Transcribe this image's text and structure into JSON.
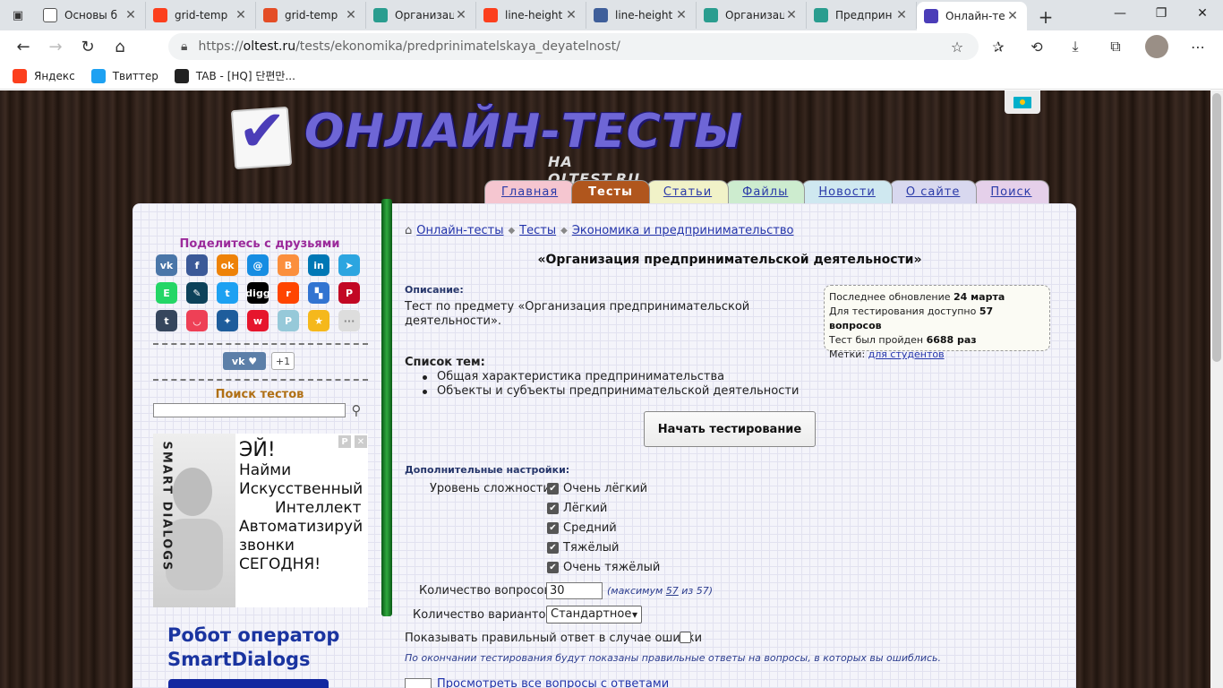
{
  "browser": {
    "tabs": [
      {
        "title": "Основы б",
        "favicon": "doc-icon",
        "color": "#ffffff"
      },
      {
        "title": "grid-temp",
        "favicon": "yandex-icon",
        "color": "#fc3f1d"
      },
      {
        "title": "grid-temp",
        "favicon": "html5-icon",
        "color": "#e44d26"
      },
      {
        "title": "Организац",
        "favicon": "oltest-icon",
        "color": "#2a9d8f"
      },
      {
        "title": "line-height",
        "favicon": "yandex-icon",
        "color": "#fc3f1d"
      },
      {
        "title": "line-height",
        "favicon": "gear-icon",
        "color": "#3f5f9a"
      },
      {
        "title": "Организац",
        "favicon": "oltest-icon",
        "color": "#2a9d8f"
      },
      {
        "title": "Предприн",
        "favicon": "oltest-icon",
        "color": "#2a9d8f"
      },
      {
        "title": "Онлайн-те",
        "favicon": "checkmark-icon",
        "color": "#4b3db8"
      }
    ],
    "url_prefix": "https://",
    "url_domain": "oltest.ru",
    "url_path": "/tests/ekonomika/predprinimatelskaya_deyatelnost/",
    "bookmarks": [
      {
        "label": "Яндекс",
        "icon": "yandex-icon",
        "color": "#fc3f1d"
      },
      {
        "label": "Твиттер",
        "icon": "twitter-icon",
        "color": "#1da1f2"
      },
      {
        "label": "TAB - [HQ] 단편만...",
        "icon": "tab-icon",
        "color": "#222222"
      }
    ]
  },
  "site": {
    "logo_name": "ОНЛАЙН-ТЕСТЫ",
    "logo_sub": "НА OLTEST.RU",
    "menu": [
      {
        "label": "Главная",
        "color": "#f5c6d0",
        "active": false
      },
      {
        "label": "Тесты",
        "color": "#b0561d",
        "active": true
      },
      {
        "label": "Статьи",
        "color": "#f1f2c8",
        "active": false
      },
      {
        "label": "Файлы",
        "color": "#cdeccf",
        "active": false
      },
      {
        "label": "Новости",
        "color": "#cfe8f0",
        "active": false
      },
      {
        "label": "О сайте",
        "color": "#d8d8ef",
        "active": false
      },
      {
        "label": "Поиск",
        "color": "#e5d0ea",
        "active": false
      }
    ]
  },
  "sidebar": {
    "share_title": "Поделитесь с друзьями",
    "social": [
      {
        "name": "vk-icon",
        "glyph": "vk",
        "color": "#4a76a8"
      },
      {
        "name": "facebook-icon",
        "glyph": "f",
        "color": "#3b5998"
      },
      {
        "name": "odnoklassniki-icon",
        "glyph": "ok",
        "color": "#ee8208"
      },
      {
        "name": "moimir-icon",
        "glyph": "@",
        "color": "#168de2"
      },
      {
        "name": "blogger-icon",
        "glyph": "B",
        "color": "#fb8f3d"
      },
      {
        "name": "linkedin-icon",
        "glyph": "in",
        "color": "#0077b5"
      },
      {
        "name": "telegram-icon",
        "glyph": "➤",
        "color": "#2ca5e0"
      },
      {
        "name": "evernote-icon",
        "glyph": "E",
        "color": "#24d666"
      },
      {
        "name": "livejournal-icon",
        "glyph": "✎",
        "color": "#0d425a"
      },
      {
        "name": "twitter-icon",
        "glyph": "t",
        "color": "#1da1f2"
      },
      {
        "name": "digg-icon",
        "glyph": "digg",
        "color": "#000000"
      },
      {
        "name": "reddit-icon",
        "glyph": "r",
        "color": "#ff4500"
      },
      {
        "name": "delicious-icon",
        "glyph": "▚",
        "color": "#3274d1"
      },
      {
        "name": "pinterest-icon",
        "glyph": "P",
        "color": "#c20724"
      },
      {
        "name": "tumblr-icon",
        "glyph": "t",
        "color": "#36465d"
      },
      {
        "name": "pocket-icon",
        "glyph": "◡",
        "color": "#ee4056"
      },
      {
        "name": "surfingbird-icon",
        "glyph": "✦",
        "color": "#1e5d9c"
      },
      {
        "name": "weibo-icon",
        "glyph": "w",
        "color": "#e6162d"
      },
      {
        "name": "misc-icon",
        "glyph": "P",
        "color": "#96c9d9"
      },
      {
        "name": "star-icon",
        "glyph": "★",
        "color": "#f5b81c"
      },
      {
        "name": "more-icon",
        "glyph": "···",
        "color": "#dddddd"
      }
    ],
    "vk_like_count": "+1",
    "search_title": "Поиск тестов",
    "ad": {
      "brand": "SMART DIALOGS",
      "lines": [
        "ЭЙ!",
        "Найми",
        "Искусственный",
        "Интеллект",
        "Автоматизируй",
        "звонки",
        "СЕГОДНЯ!"
      ],
      "ctrl_label": "Р",
      "close_label": "✕"
    },
    "ad2": {
      "line1": "Робот оператор",
      "line2": "SmartDialogs"
    }
  },
  "main": {
    "breadcrumb": [
      "Онлайн-тесты",
      "Тесты",
      "Экономика и предпринимательство"
    ],
    "title": "«Организация предпринимательской деятельности»",
    "description_label": "Описание:",
    "description": "Тест по предмету «Организация предпринимательской деятельности».",
    "info": {
      "updated_label": "Последнее обновление",
      "updated_value": "24 марта",
      "available_label": "Для тестирования доступно",
      "available_value": "57 вопросов",
      "passed_label": "Тест был пройден",
      "passed_value": "6688 раз",
      "tags_label": "Метки:",
      "tags_value": "для студентов"
    },
    "topics_label": "Список тем:",
    "topics": [
      "Общая характеристика предпринимательства",
      "Объекты и субъекты предпринимательской деятельности"
    ],
    "start_button": "Начать тестирование",
    "extra_label": "Дополнительные настройки:",
    "difficulty_label": "Уровень сложности:",
    "difficulty": [
      "Очень лёгкий",
      "Лёгкий",
      "Средний",
      "Тяжёлый",
      "Очень тяжёлый"
    ],
    "qcount_label": "Количество вопросов:",
    "qcount_value": "30",
    "qmax_prefix": "(максимум",
    "qmax_value": "57",
    "qmax_suffix": "из 57)",
    "variants_label": "Количество вариантов:",
    "variants_value": "Стандартное",
    "show_answer_label": "Показывать правильный ответ в случае ошибки",
    "note": "По окончании тестирования будут показаны правильные ответы на вопросы, в которых вы ошиблись.",
    "view_all": "Просмотреть все вопросы с ответами"
  }
}
